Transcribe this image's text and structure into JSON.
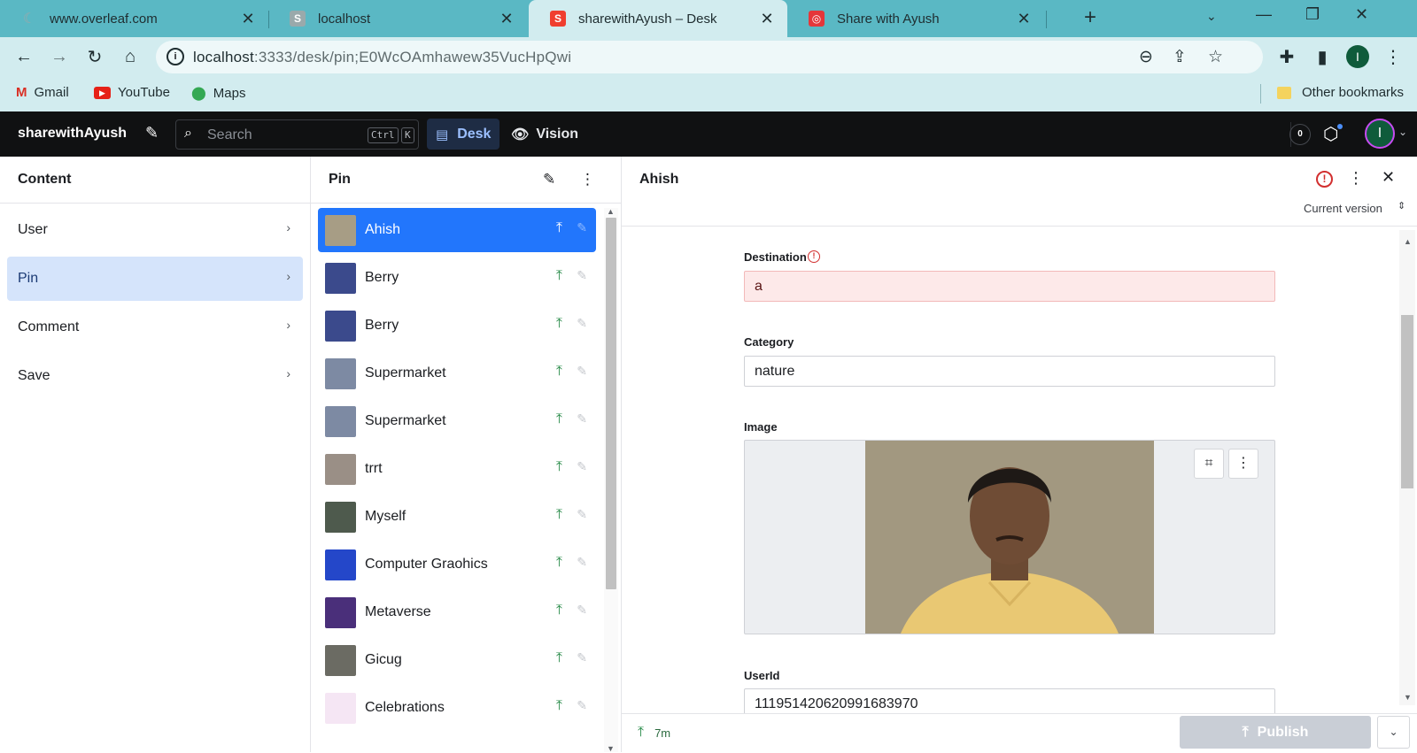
{
  "browser": {
    "tabs": [
      {
        "title": "www.overleaf.com",
        "icon": "overleaf-icon",
        "color": "#9aa9ab"
      },
      {
        "title": "localhost",
        "icon": "sanity-icon",
        "color": "#9aa9ab"
      },
      {
        "title": "sharewithAyush – Desk",
        "icon": "sanity-icon",
        "color": "#f03e2f",
        "active": true
      },
      {
        "title": "Share with Ayush",
        "icon": "camera-icon",
        "color": "#e5363a"
      }
    ],
    "url_host": "localhost",
    "url_rest": ":3333/desk/pin;E0WcOAmhawew35VucHpQwi",
    "profile_initial": "I",
    "bookmarks": [
      {
        "label": "Gmail",
        "icon": "gmail-icon"
      },
      {
        "label": "YouTube",
        "icon": "youtube-icon"
      },
      {
        "label": "Maps",
        "icon": "maps-icon"
      }
    ],
    "other_bookmarks": "Other bookmarks"
  },
  "studio": {
    "brand": "sharewithAyush",
    "search_placeholder": "Search",
    "kbd_ctrl": "Ctrl",
    "kbd_k": "K",
    "desk_label": "Desk",
    "vision_label": "Vision",
    "notifications_count": "0",
    "user_initial": "I",
    "accent": "#2276fc"
  },
  "content_pane": {
    "title": "Content",
    "types": [
      {
        "label": "User"
      },
      {
        "label": "Pin",
        "selected": true
      },
      {
        "label": "Comment"
      },
      {
        "label": "Save"
      }
    ]
  },
  "pin_pane": {
    "title": "Pin",
    "items": [
      {
        "label": "Ahish",
        "selected": true,
        "thumb": "#a79d85"
      },
      {
        "label": "Berry",
        "thumb": "#3b4a8c"
      },
      {
        "label": "Berry",
        "thumb": "#3b4a8c"
      },
      {
        "label": "Supermarket",
        "thumb": "#7d8aa3"
      },
      {
        "label": "Supermarket",
        "thumb": "#7d8aa3"
      },
      {
        "label": "trrt",
        "thumb": "#9a8f86"
      },
      {
        "label": "Myself",
        "thumb": "#4e5a4d"
      },
      {
        "label": "Computer Graohics",
        "thumb": "#2447c9"
      },
      {
        "label": "Metaverse",
        "thumb": "#4a2f7a"
      },
      {
        "label": "Gicug",
        "thumb": "#6b6b63"
      },
      {
        "label": "Celebrations",
        "thumb": "#f5e6f4"
      }
    ]
  },
  "document": {
    "title": "Ahish",
    "version_label": "Current version",
    "fields": {
      "destination_label": "Destination",
      "destination_value": "a",
      "category_label": "Category",
      "category_value": "nature",
      "image_label": "Image",
      "userid_label": "UserId",
      "userid_value": "111951420620991683970"
    },
    "footer_status": "7m",
    "publish_label": "Publish"
  }
}
